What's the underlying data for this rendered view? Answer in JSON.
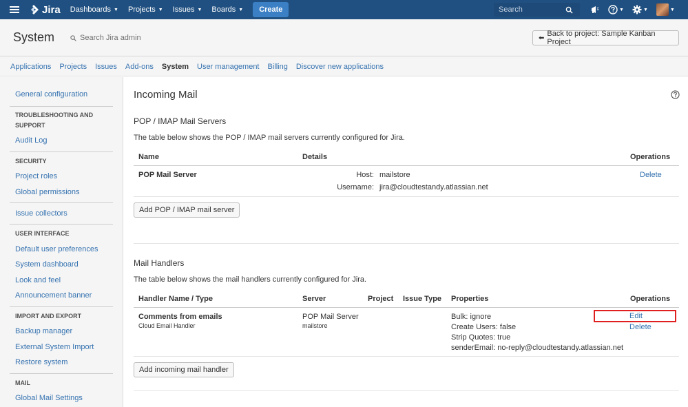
{
  "nav": {
    "logo": "Jira",
    "items": [
      {
        "label": "Dashboards"
      },
      {
        "label": "Projects"
      },
      {
        "label": "Issues"
      },
      {
        "label": "Boards"
      }
    ],
    "create_label": "Create",
    "search_placeholder": "Search"
  },
  "header": {
    "title": "System",
    "admin_search": "Search Jira admin",
    "back_button": "Back to project: Sample Kanban Project"
  },
  "tabs": [
    {
      "label": "Applications"
    },
    {
      "label": "Projects"
    },
    {
      "label": "Issues"
    },
    {
      "label": "Add-ons"
    },
    {
      "label": "System"
    },
    {
      "label": "User management"
    },
    {
      "label": "Billing"
    },
    {
      "label": "Discover new applications"
    }
  ],
  "sidebar": {
    "general": "General configuration",
    "troubleshooting_head": "TROUBLESHOOTING AND SUPPORT",
    "audit_log": "Audit Log",
    "security_head": "SECURITY",
    "project_roles": "Project roles",
    "global_permissions": "Global permissions",
    "issue_collectors": "Issue collectors",
    "ui_head": "USER INTERFACE",
    "default_prefs": "Default user preferences",
    "system_dashboard": "System dashboard",
    "look_feel": "Look and feel",
    "announcement": "Announcement banner",
    "import_head": "IMPORT AND EXPORT",
    "backup": "Backup manager",
    "external_import": "External System Import",
    "restore": "Restore system",
    "mail_head": "MAIL",
    "global_mail": "Global Mail Settings"
  },
  "main": {
    "title": "Incoming Mail",
    "pop": {
      "title": "POP / IMAP Mail Servers",
      "desc": "The table below shows the POP / IMAP mail servers currently configured for Jira.",
      "col_name": "Name",
      "col_details": "Details",
      "col_ops": "Operations",
      "row_name": "POP Mail Server",
      "host_label": "Host:",
      "host_value": "mailstore",
      "user_label": "Username:",
      "user_value": "jira@cloudtestandy.atlassian.net",
      "delete": "Delete",
      "add_button": "Add POP / IMAP mail server"
    },
    "handlers": {
      "title": "Mail Handlers",
      "desc": "The table below shows the mail handlers currently configured for Jira.",
      "col_name": "Handler Name / Type",
      "col_server": "Server",
      "col_project": "Project",
      "col_issue_type": "Issue Type",
      "col_props": "Properties",
      "col_ops": "Operations",
      "row_name": "Comments from emails",
      "row_type": "Cloud Email Handler",
      "row_server": "POP Mail Server",
      "row_server_sub": "mailstore",
      "prop_bulk": "Bulk: ignore",
      "prop_create_users": "Create Users: false",
      "prop_strip_quotes": "Strip Quotes: true",
      "prop_sender": "senderEmail: no-reply@cloudtestandy.atlassian.net",
      "edit": "Edit",
      "delete": "Delete",
      "add_button": "Add incoming mail handler"
    }
  },
  "colors": {
    "nav_bg": "#205081",
    "link": "#3572b0",
    "highlight": "#e02020"
  }
}
